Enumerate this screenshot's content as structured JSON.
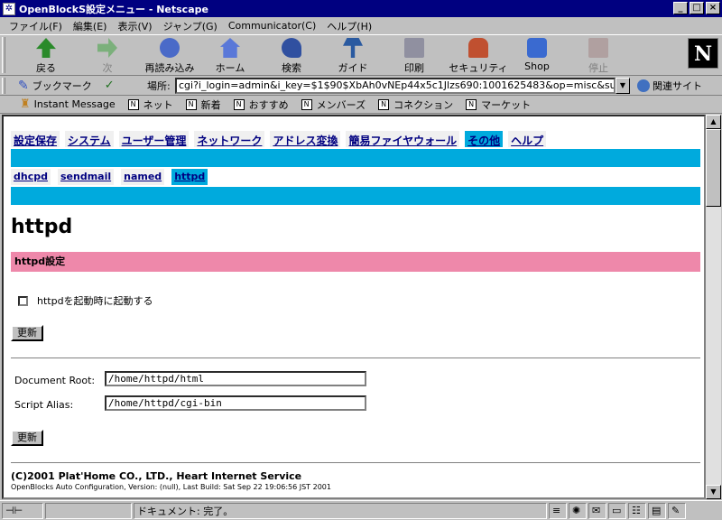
{
  "window": {
    "title": "OpenBlockS設定メニュー - Netscape",
    "min": "_",
    "max": "□",
    "close": "×"
  },
  "menu": [
    "ファイル(F)",
    "編集(E)",
    "表示(V)",
    "ジャンプ(G)",
    "Communicator(C)",
    "ヘルプ(H)"
  ],
  "toolbar": {
    "back": "戻る",
    "forward": "次",
    "reload": "再読み込み",
    "home": "ホーム",
    "search": "検索",
    "guide": "ガイド",
    "print": "印刷",
    "security": "セキュリティ",
    "shop": "Shop",
    "stop": "停止",
    "logo": "N"
  },
  "location": {
    "bookmarks": "ブックマーク",
    "label": "場所:",
    "url": "cgi?i_login=admin&i_key=$1$90$XbAh0vNEp44x5c1Jlzs690:1001625483&op=misc&subop=httpd",
    "related": "関連サイト"
  },
  "personal": [
    "Instant Message",
    "ネット",
    "新着",
    "おすすめ",
    "メンバーズ",
    "コネクション",
    "マーケット"
  ],
  "tabs": [
    "設定保存",
    "システム",
    "ユーザー管理",
    "ネットワーク",
    "アドレス変換",
    "簡易ファイヤウォール",
    "その他",
    "ヘルプ"
  ],
  "subtabs": [
    "dhcpd",
    "sendmail",
    "named",
    "httpd"
  ],
  "page": {
    "heading": "httpd",
    "section": "httpd設定",
    "checkbox_label": "httpdを起動時に起動する",
    "update": "更新",
    "docroot_label": "Document Root:",
    "docroot_value": "/home/httpd/html",
    "alias_label": "Script Alias:",
    "alias_value": "/home/httpd/cgi-bin"
  },
  "footer": {
    "copyright": "(C)2001 Plat'Home CO., LTD., Heart Internet Service",
    "build": "OpenBlocks Auto Configuration, Version: (null), Last Build: Sat Sep 22 19:06:56 JST 2001"
  },
  "status": {
    "text": "ドキュメント: 完了。"
  }
}
